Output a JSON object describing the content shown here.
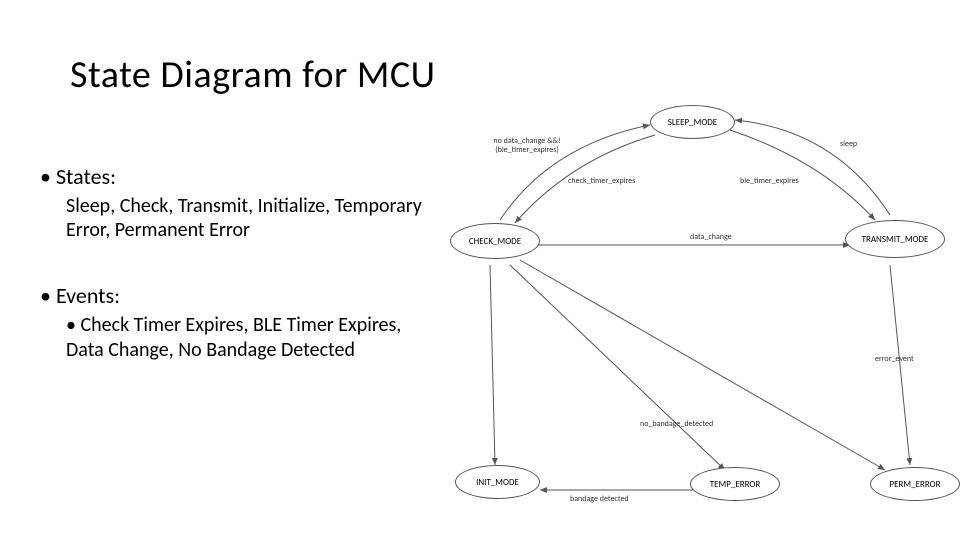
{
  "title": "State Diagram for MCU",
  "left": {
    "states_header": "States:",
    "states_body": "Sleep, Check, Transmit, Initialize, Temporary Error, Permanent Error",
    "events_header": "Events:",
    "events_body": "Check Timer Expires, BLE Timer Expires, Data Change, No Bandage Detected"
  },
  "diagram": {
    "states": {
      "sleep": "SLEEP_MODE",
      "check": "CHECK_MODE",
      "transmit": "TRANSMIT_MODE",
      "init": "INIT_MODE",
      "temp": "TEMP_ERROR",
      "perm": "PERM_ERROR"
    },
    "edges": {
      "sleep_to_check": "check_timer_expires",
      "check_to_sleep": "no data_change &&!(ble_timer_expires)",
      "sleep_to_transmit": "ble_timer_expires",
      "transmit_to_sleep": "sleep",
      "check_to_transmit": "data_change",
      "transmit_to_perm": "error_event",
      "check_to_temp": "no_bandage_detected",
      "temp_to_init": "bandage detected"
    }
  }
}
